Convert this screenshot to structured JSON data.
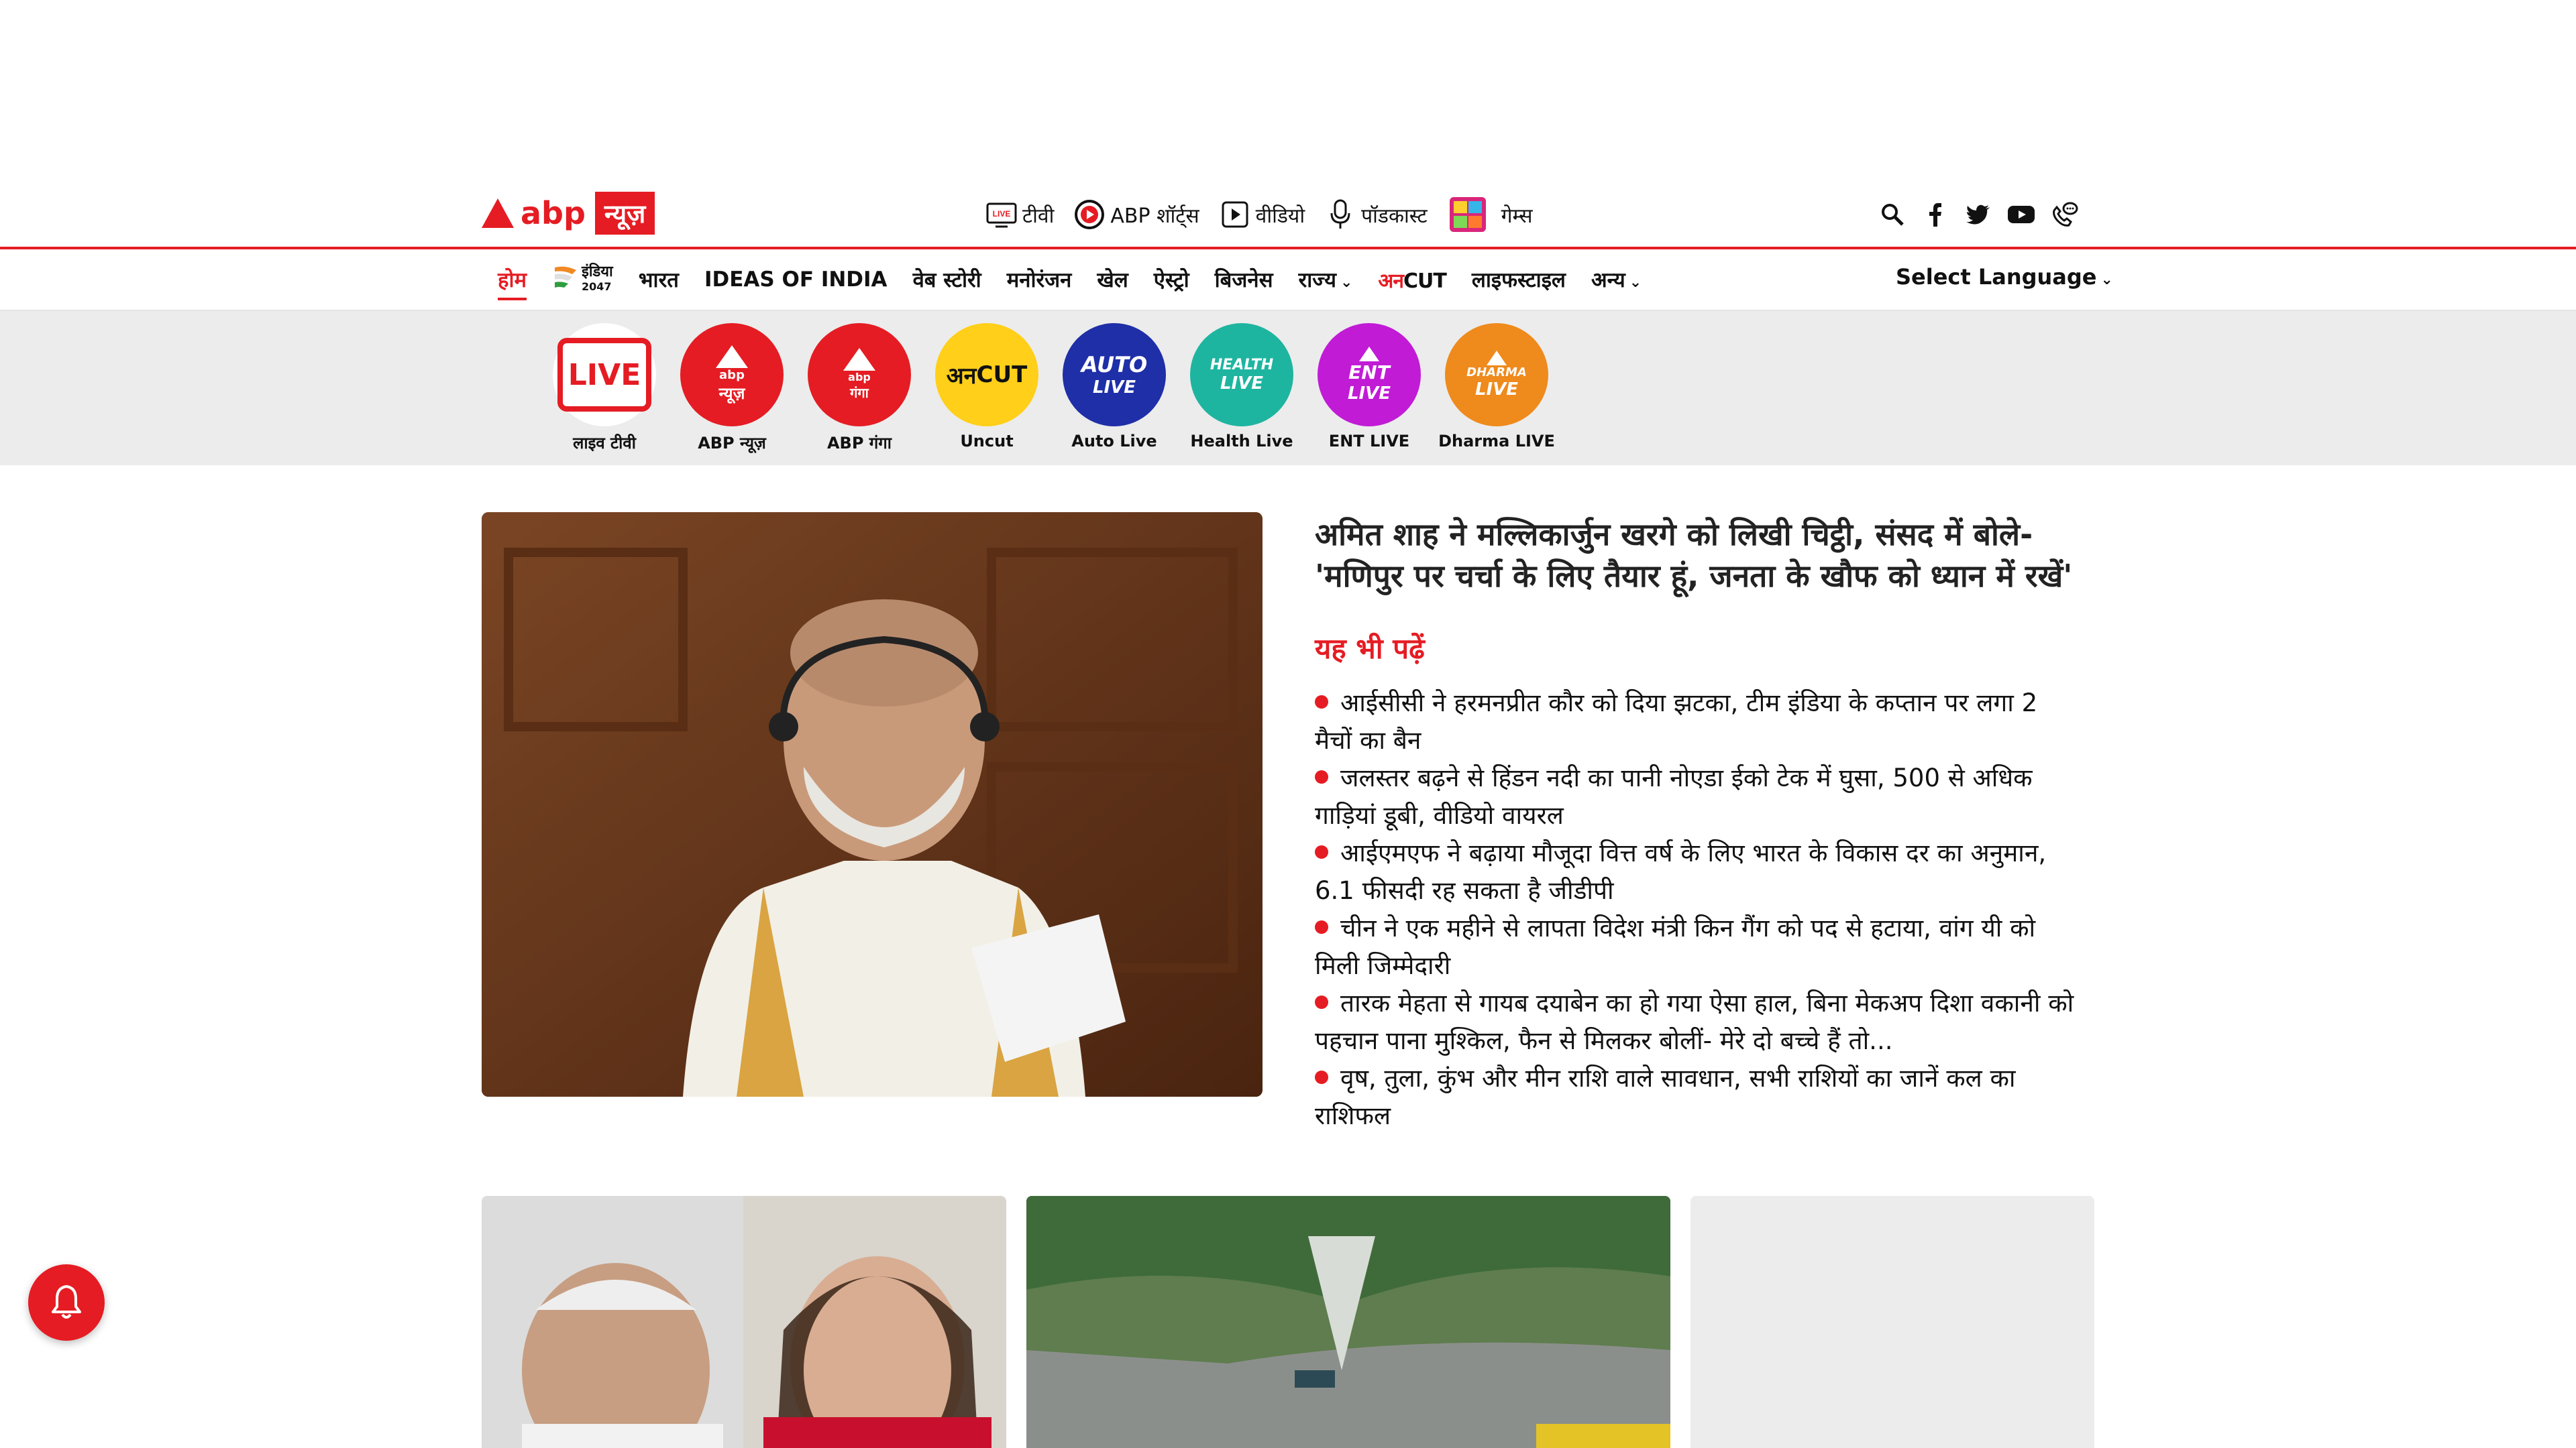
{
  "logo": {
    "brand": "abp",
    "box_text": "न्यूज़",
    "color": "#e51c23"
  },
  "topnav": [
    {
      "label": "टीवी",
      "icon": "live-tv-icon"
    },
    {
      "label": "ABP शॉर्ट्स",
      "icon": "shorts-play-icon"
    },
    {
      "label": "वीडियो",
      "icon": "video-play-icon"
    },
    {
      "label": "पॉडकास्ट",
      "icon": "microphone-icon"
    },
    {
      "label": "गेम्स",
      "icon": "games-icon"
    }
  ],
  "header_icons": [
    "search-icon",
    "facebook-icon",
    "twitter-icon",
    "youtube-icon",
    "phone-chat-icon"
  ],
  "mainnav": {
    "home": "होम",
    "india2047_line1": "इंडिया",
    "india2047_line2": "2047",
    "bharat": "भारत",
    "ideas": "IDEAS OF INDIA",
    "web_story": "वेब स्टोरी",
    "manoranjan": "मनोरंजन",
    "khel": "खेल",
    "astro": "ऐस्ट्रो",
    "business": "बिजनेस",
    "rajya": "राज्य",
    "uncut_a": "अन",
    "uncut_b": "CUT",
    "lifestyle": "लाइफस्टाइल",
    "anya": "अन्य",
    "select_language": "Select Language"
  },
  "channels": [
    {
      "label": "लाइव टीवी",
      "badge": "LIVE"
    },
    {
      "label": "ABP न्यूज़",
      "top": "abp",
      "bottom": "न्यूज़"
    },
    {
      "label": "ABP गंगा",
      "top": "abp",
      "bottom": "गंगा"
    },
    {
      "label": "Uncut",
      "top": "अन",
      "bottom": "CUT"
    },
    {
      "label": "Auto Live",
      "top": "AUTO",
      "bottom": "LIVE"
    },
    {
      "label": "Health Live",
      "top": "HEALTH",
      "bottom": "LIVE"
    },
    {
      "label": "ENT LIVE",
      "top": "ENT",
      "bottom": "LIVE"
    },
    {
      "label": "Dharma LIVE",
      "top": "DHARMA",
      "bottom": "LIVE"
    }
  ],
  "hero": {
    "title": "अमित शाह ने मल्लिकार्जुन खरगे को लिखी चिट्ठी, संसद में बोले- 'मणिपुर पर चर्चा के लिए तैयार हूं, जनता के खौफ को ध्यान में रखें'",
    "also_read": "यह भी पढ़ें",
    "related": [
      "आईसीसी ने हरमनप्रीत कौर को दिया झटका, टीम इंडिया के कप्तान पर लगा 2 मैचों का बैन",
      "जलस्तर बढ़ने से हिंडन नदी का पानी नोएडा ईको टेक में घुसा, 500 से अधिक गाड़ियां डूबी, वीडियो वायरल",
      "आईएमएफ ने बढ़ाया मौजूदा वित्त वर्ष के लिए भारत के विकास दर का अनुमान, 6.1 फीसदी रह सकता है जीडीपी",
      "चीन ने एक महीने से लापता विदेश मंत्री किन गैंग को पद से हटाया, वांग यी को मिली जिम्मेदारी",
      "तारक मेहता से गायब दयाबेन का हो गया ऐसा हाल, बिना मेकअप दिशा वकानी को पहचान पाना मुश्किल, फैन से मिलकर बोलीं- मेरे दो बच्चे हैं तो...",
      "वृष, तुला, कुंभ और मीन राशि वाले सावधान, सभी राशियों का जानें कल का राशिफल"
    ]
  },
  "colors": {
    "accent": "#e51c23",
    "channel_bg": "#ececec"
  }
}
